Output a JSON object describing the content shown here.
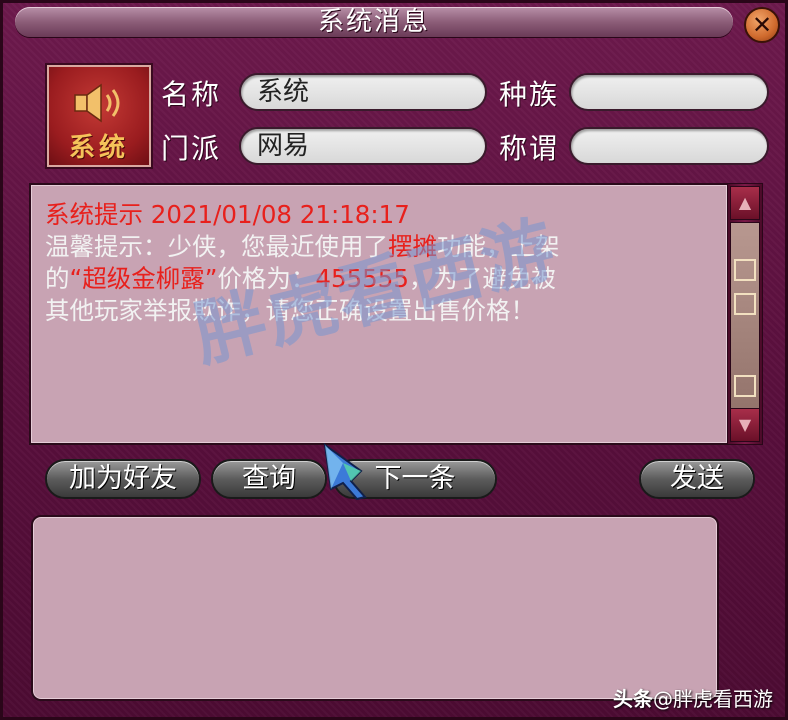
{
  "window": {
    "title": "系统消息"
  },
  "avatar": {
    "label": "系统",
    "icon": "speaker-icon"
  },
  "labels": {
    "name": "名称",
    "race": "种族",
    "sect": "门派",
    "title": "称谓"
  },
  "fields": {
    "name": "系统",
    "race": "",
    "sect": "网易",
    "title": ""
  },
  "message": {
    "header": "系统提示 2021/01/08 21:18:17",
    "line1_a": "温馨提示：少侠，您最近使用了",
    "line1_b": "摆摊",
    "line1_c": "功能，上架",
    "line2_a": "的",
    "line2_b": "“超级金柳露”",
    "line2_c": "价格为：",
    "line2_d": "455555",
    "line2_e": "，为了避免被",
    "line3": "其他玩家举报欺诈，请您正确设置出售价格！"
  },
  "buttons": {
    "add_friend": "加为好友",
    "query": "查询",
    "next": "下一条",
    "send": "发送"
  },
  "watermark": "胖虎看西游",
  "footer": {
    "brand": "头条",
    "handle": "@胖虎看西游"
  },
  "colors": {
    "frame": "#5a0f3c",
    "panel": "#c8a3b3",
    "highlight_red": "#e8201c",
    "avatar_text": "#f5c35a"
  }
}
